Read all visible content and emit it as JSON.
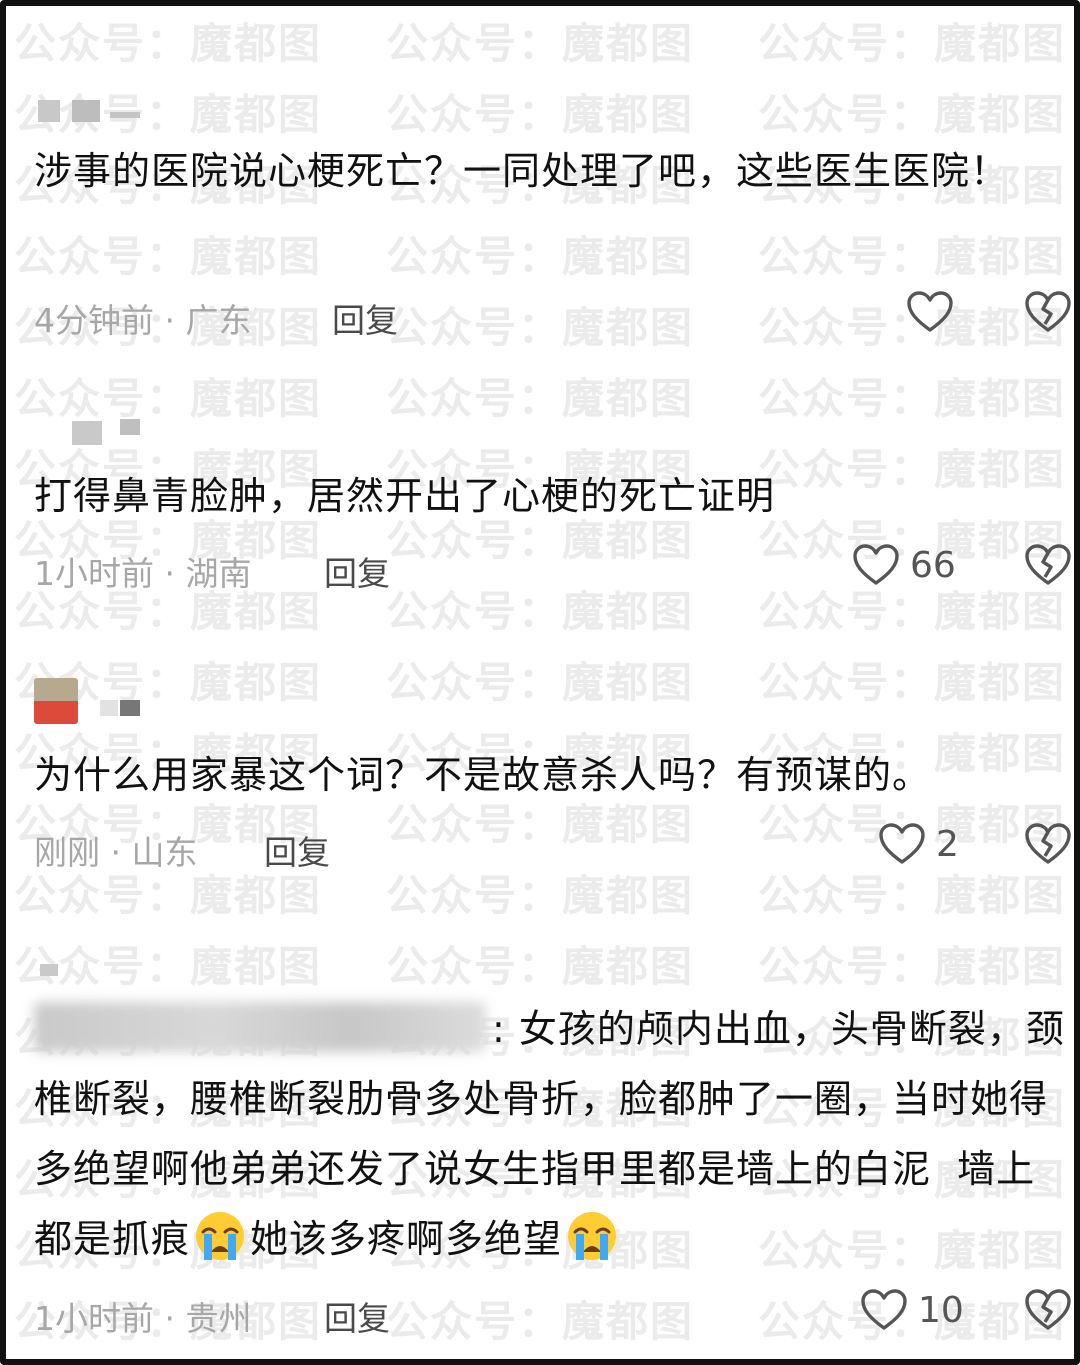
{
  "watermark": {
    "text": "公众号：魔都图"
  },
  "comments": [
    {
      "text": "涉事的医院说心梗死亡？一同处理了吧，这些医生医院！",
      "time": "4分钟前",
      "location": "广东",
      "reply_label": "回复",
      "like_count": ""
    },
    {
      "text": "打得鼻青脸肿，居然开出了心梗的死亡证明",
      "time": "1小时前",
      "location": "湖南",
      "reply_label": "回复",
      "like_count": "66"
    },
    {
      "text": "为什么用家暴这个词？不是故意杀人吗？有预谋的。",
      "time": "刚刚",
      "location": "山东",
      "reply_label": "回复",
      "like_count": "2"
    },
    {
      "text_part1": ": 女孩的颅内出血，头骨断裂，颈椎断裂，腰椎断裂肋骨多处骨折，脸都肿了一圈，当时她得多绝望啊他弟弟还发了说女生指甲里都是墙上的白泥  墙上都是抓痕",
      "text_part2": "她该多疼啊多绝望",
      "emoji": "crying-face",
      "time": "1小时前",
      "location": "贵州",
      "reply_label": "回复",
      "like_count": "10"
    }
  ],
  "meta_separator": " · ",
  "colors": {
    "meta": "#a7a7a7",
    "text": "#111111",
    "reply": "#4a4a4a",
    "watermark": "#ebebeb"
  },
  "icons": {
    "like": "heart-outline-icon",
    "dislike": "broken-heart-icon"
  }
}
